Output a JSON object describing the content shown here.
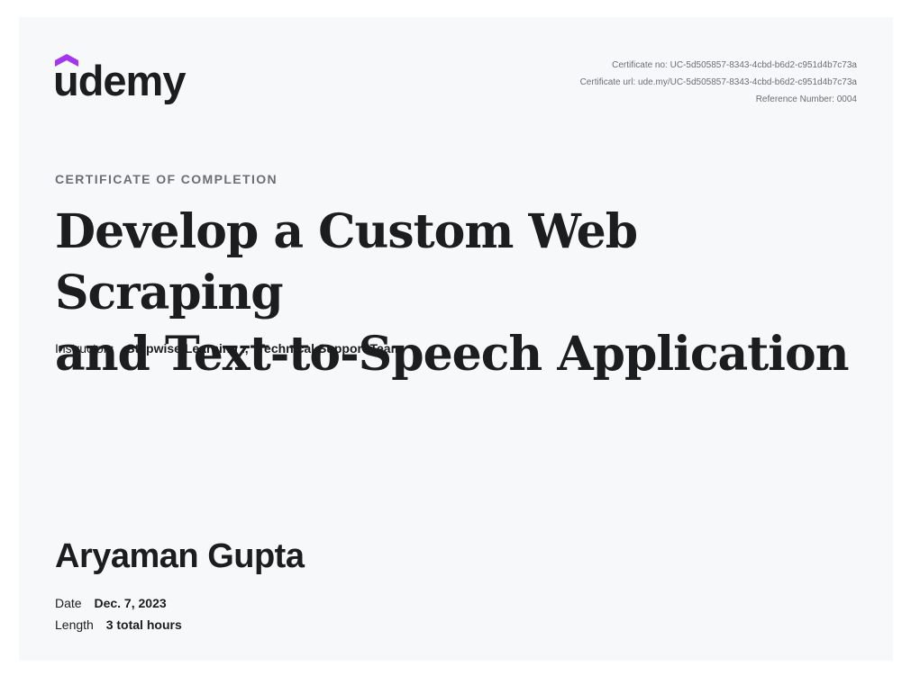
{
  "brand": {
    "logo_text": "udemy",
    "accent_color": "#a435f0",
    "ink_color": "#1c1d1f"
  },
  "meta": {
    "certificate_no": "Certificate no: UC-5d505857-8343-4cbd-b6d2-c951d4b7c73a",
    "certificate_url": "Certificate url: ude.my/UC-5d505857-8343-4cbd-b6d2-c951d4b7c73a",
    "reference_number": "Reference Number: 0004"
  },
  "certificate": {
    "kicker": "CERTIFICATE OF COMPLETION",
    "title_line1": "Develop a Custom Web Scraping",
    "title_line2": "and Text-to-Speech Application"
  },
  "instructors": {
    "label": "Instructors",
    "names": [
      "Stepwise Learning .",
      "Technical Support Team"
    ],
    "separator": ","
  },
  "recipient": {
    "name": "Aryaman Gupta"
  },
  "details": {
    "date_label": "Date",
    "date_value": "Dec. 7, 2023",
    "length_label": "Length",
    "length_value": "3 total hours"
  }
}
